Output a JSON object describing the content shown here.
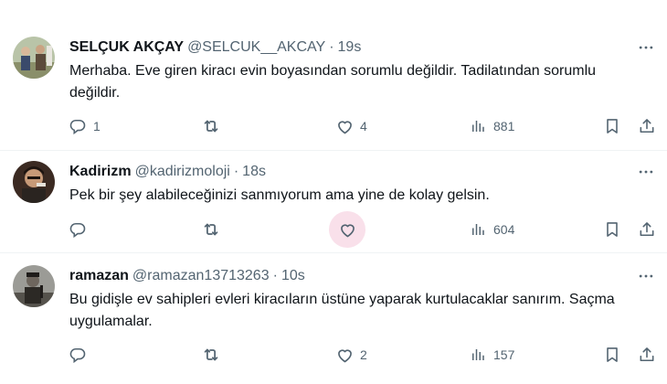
{
  "tweets": [
    {
      "name": "SELÇUK AKÇAY",
      "handle": "@SELCUK__AKCAY",
      "separator": "·",
      "time": "19s",
      "text": "Merhaba. Eve giren kiracı evin boyasından sorumlu değildir. Tadilatından sorumlu değildir.",
      "replies": "1",
      "retweets": "",
      "likes": "4",
      "views": "881"
    },
    {
      "name": "Kadirizm",
      "handle": "@kadirizmoloji",
      "separator": "·",
      "time": "18s",
      "text": "Pek bir şey alabileceğinizi sanmıyorum ama yine de kolay gelsin.",
      "replies": "",
      "retweets": "",
      "likes": "",
      "views": "604"
    },
    {
      "name": "ramazan",
      "handle": "@ramazan13713263",
      "separator": "·",
      "time": "10s",
      "text": "Bu gidişle ev sahipleri evleri kiracıların üstüne yaparak kurtulacaklar sanırım. Saçma uygulamalar.",
      "replies": "",
      "retweets": "",
      "likes": "2",
      "views": "157"
    }
  ],
  "icons": {
    "reply": "reply-icon",
    "retweet": "retweet-icon",
    "like": "heart-icon",
    "views": "views-icon",
    "bookmark": "bookmark-icon",
    "share": "share-icon",
    "more": "more-icon"
  },
  "colors": {
    "text": "#0f1419",
    "secondary": "#536471",
    "like_hover_bg": "#f9e0ea",
    "divider": "#eff3f4"
  }
}
